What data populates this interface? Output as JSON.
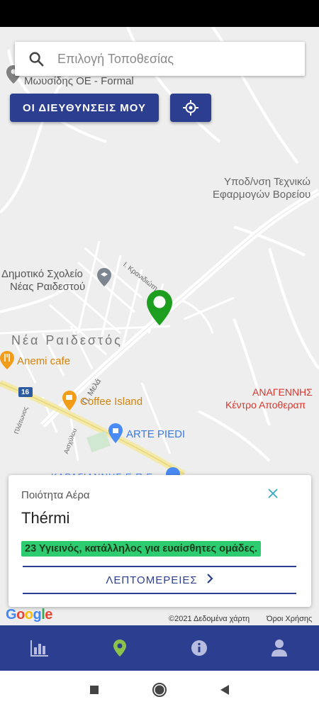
{
  "search": {
    "placeholder": "Επιλογή Τοποθεσίας",
    "icon": "search-icon"
  },
  "buttons": {
    "my_addresses": "ΟΙ ΔΙΕΥΘΥΝΣΕΙΣ ΜΟΥ",
    "my_location_icon": "gps-crosshair-icon"
  },
  "map_labels": {
    "formal": "Μωυσίδης ΟΕ - Formal",
    "tech_school_1": "Υποδ/νση Τεχνικώ",
    "tech_school_2": "Εφαρμογών Βορείου",
    "street_kranidiou": "Ι. Κρανιδιώτη",
    "school_1": "Δημοτικό Σχολείο",
    "school_2": "Νέας Ραιδεστού",
    "town": "Νέα Ραιδεστός",
    "anemi": "Anemi cafe",
    "street_mela": "Π. Μελά",
    "road_number": "16",
    "street_platonos": "Πλάτωνος",
    "coffee": "Coffee Island",
    "anagennisi_1": "ΑΝΑΓΕΝΝΗΣ",
    "anagennisi_2": "Κέντρο Αποθεραπ",
    "street_aischylou": "Αισχύλου",
    "arte": "ARTE PIEDI",
    "hidden_business": "ΚΑΡΑΓΙΑΝΝΗΣ Ε.Π.Ε."
  },
  "card": {
    "label": "Ποιότητα Αέρα",
    "city": "Thérmi",
    "aq_value": "23",
    "aq_text": "Υγιεινός, κατάλληλος για ευαίσθητες ομάδες.",
    "aq_color": "#2ecc71",
    "details_button": "ΛΕΠΤΟΜΕΡΕΙΕΣ"
  },
  "map_footer": {
    "logo": "Google",
    "credits": "©2021 Δεδομένα χάρτη",
    "terms": "Όροι Χρήσης"
  },
  "bottom_nav": [
    {
      "icon": "bar-chart-icon",
      "active": false
    },
    {
      "icon": "location-pin-icon",
      "active": true
    },
    {
      "icon": "info-icon",
      "active": false
    },
    {
      "icon": "person-icon",
      "active": false
    }
  ],
  "system_nav": [
    "recents-square-icon",
    "home-circle-icon",
    "back-triangle-icon"
  ],
  "colors": {
    "primary": "#2c3e8f",
    "marker": "#1e9e1e",
    "active_nav": "#8bc34a",
    "badge": "#2ecc71"
  }
}
